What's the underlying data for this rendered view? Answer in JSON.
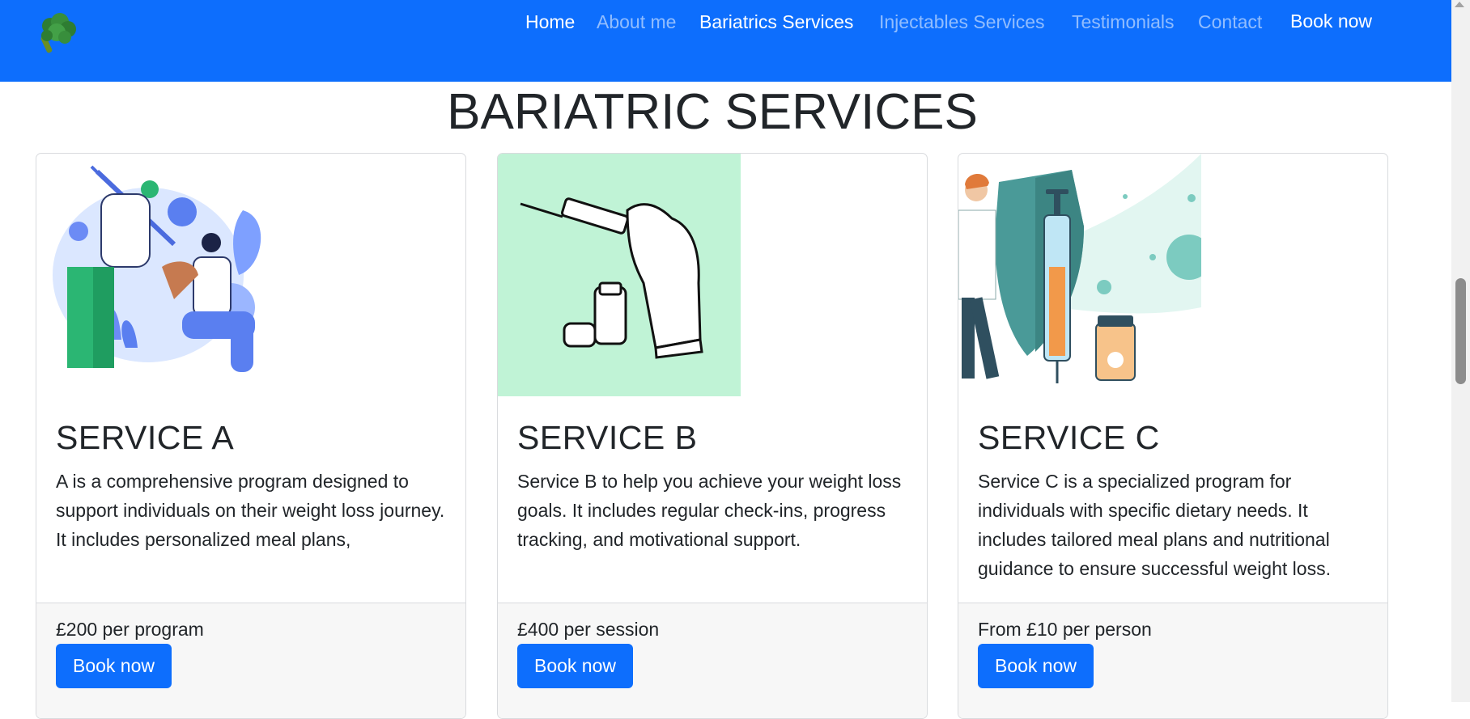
{
  "navbar": {
    "logo_icon": "broccoli-icon",
    "links": [
      {
        "label": "Home",
        "active": true
      },
      {
        "label": "About me",
        "active": false
      },
      {
        "label": "Bariatrics Services",
        "active": true
      },
      {
        "label": "Injectables Services",
        "active": false
      },
      {
        "label": "Testimonials",
        "active": false
      },
      {
        "label": "Contact",
        "active": false
      }
    ],
    "book_label": "Book now"
  },
  "page": {
    "title": "BARIATRIC SERVICES"
  },
  "services": [
    {
      "image": "vaccination-illustration",
      "title": "SERVICE A",
      "description": "A is a comprehensive program designed to support individuals on their weight loss journey. It includes personalized meal plans,",
      "price": "£200 per program",
      "button_label": "Book now"
    },
    {
      "image": "syringe-vial-illustration",
      "title": "SERVICE B",
      "description": "Service B to help you achieve your weight loss goals. It includes regular check-ins, progress tracking, and motivational support.",
      "price": "£400 per session",
      "button_label": "Book now"
    },
    {
      "image": "doctor-syringe-illustration",
      "title": "SERVICE C",
      "description": "Service C is a specialized program for individuals with specific dietary needs. It includes tailored meal plans and nutritional guidance to ensure successful weight loss.",
      "price": "From £10 per person",
      "button_label": "Book now"
    }
  ],
  "colors": {
    "primary": "#0d6efd",
    "card_border": "#d9dbde",
    "footer_bg": "#f7f7f7",
    "mint": "#c0f3d6"
  }
}
